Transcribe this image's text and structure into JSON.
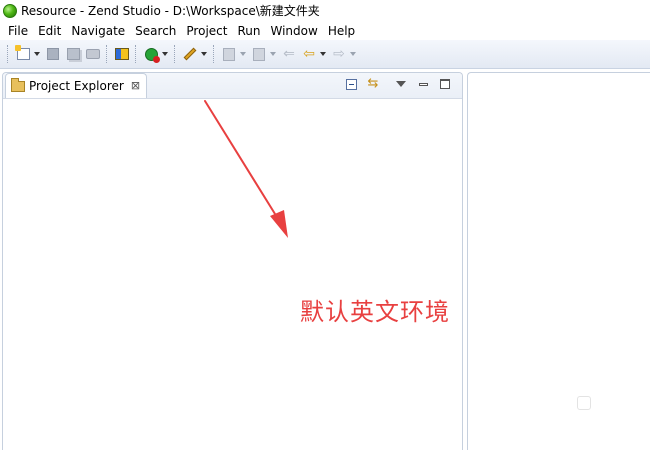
{
  "window": {
    "title": "Resource - Zend Studio - D:\\Workspace\\新建文件夹"
  },
  "menu": {
    "items": [
      "File",
      "Edit",
      "Navigate",
      "Search",
      "Project",
      "Run",
      "Window",
      "Help"
    ]
  },
  "toolbar": {
    "icons": [
      "new-icon",
      "save-icon",
      "save-all-icon",
      "print-icon",
      "build-icon",
      "run-icon",
      "edit-pen-icon",
      "next-annotation-icon",
      "prev-annotation-icon",
      "back-icon",
      "forward-icon"
    ]
  },
  "project_explorer": {
    "tab_label": "Project Explorer",
    "close_glyph": "⊠"
  },
  "annotation": {
    "text": "默认英文环境",
    "color": "#e84040"
  },
  "colors": {
    "toolbar_bg": "#e3e9f3",
    "panel_border": "#c6d0de",
    "annotation": "#e84040"
  }
}
